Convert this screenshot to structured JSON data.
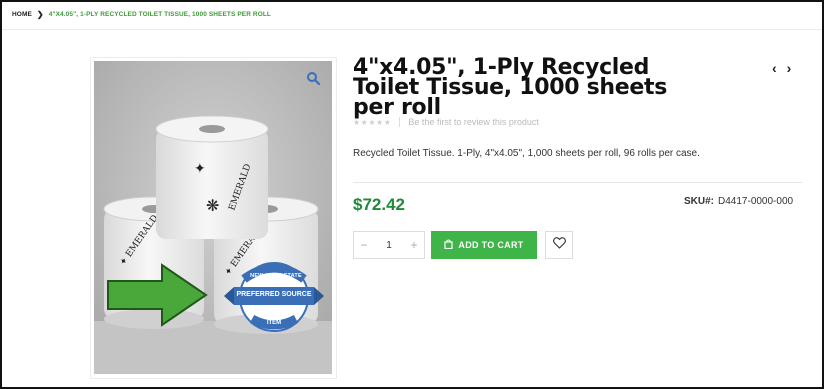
{
  "breadcrumb": {
    "home": "HOME",
    "separator": "❯",
    "current": "4\"X4.05\", 1-PLY RECYCLED TOILET TISSUE, 1000 SHEETS PER ROLL"
  },
  "product": {
    "title": "4\"x4.05\", 1-Ply Recycled Toilet Tissue, 1000 sheets per roll",
    "rating_stars": "★★★★★",
    "review_link": "Be the first to review this product",
    "description": "Recycled Toilet Tissue. 1-Ply, 4\"x4.05\", 1,000 sheets per roll, 96 rolls per case.",
    "price": "$72.42",
    "sku_label": "SKU#:",
    "sku_value": "D4417-0000-000",
    "quantity": "1",
    "minus": "−",
    "plus": "+",
    "add_to_cart": "ADD TO CART"
  },
  "nav": {
    "prev": "‹",
    "next": "›"
  },
  "image": {
    "badge_top": "NEW YORK STATE",
    "badge_middle": "PREFERRED SOURCE",
    "badge_bottom": "ITEM",
    "brand_text": "EMERALD"
  },
  "colors": {
    "accent_green": "#3fb449",
    "price_green": "#1f8a3a",
    "breadcrumb_green": "#3f9a3a",
    "arrow_green": "#4aa83a",
    "badge_blue": "#3a6fb8"
  },
  "icons": [
    "zoom-icon",
    "cart-bag-icon",
    "heart-icon",
    "arrow-left-icon",
    "arrow-right-icon"
  ]
}
